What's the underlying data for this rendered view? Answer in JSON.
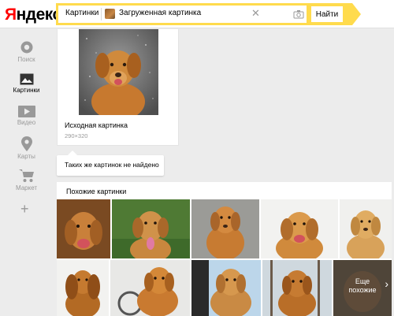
{
  "header": {
    "logo": "Яндекс",
    "search": {
      "scope_label": "Картинки",
      "uploaded_label": "Загруженная картинка",
      "clear_icon": "close-icon",
      "camera_icon": "camera-icon"
    },
    "find_button": "Найти"
  },
  "sidebar": {
    "items": [
      {
        "label": "Поиск",
        "icon": "search-icon"
      },
      {
        "label": "Картинки",
        "icon": "images-icon"
      },
      {
        "label": "Видео",
        "icon": "video-icon"
      },
      {
        "label": "Карты",
        "icon": "map-pin-icon"
      },
      {
        "label": "Маркет",
        "icon": "cart-icon"
      }
    ],
    "more_icon": "plus-icon",
    "plus_symbol": "+"
  },
  "source_image": {
    "title": "Исходная картинка",
    "size": "290×320"
  },
  "same_images": {
    "message": "Таких же картинок не найдено"
  },
  "similar": {
    "title": "Похожие картинки",
    "more_label_line1": "Еще",
    "more_label_line2": "похожие",
    "more_chevron": "›"
  },
  "colors": {
    "accent_yellow": "#ffdb4d",
    "logo_red": "#ff0000",
    "page_bg": "#ececec"
  }
}
